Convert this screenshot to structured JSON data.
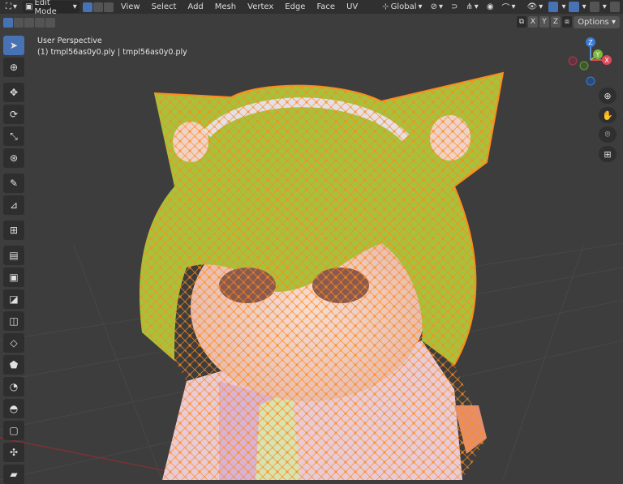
{
  "topbar": {
    "editor_icon": "viewport-icon",
    "mode_label": "Edit Mode",
    "menus": [
      "View",
      "Select",
      "Add",
      "Mesh",
      "Vertex",
      "Edge",
      "Face",
      "UV"
    ],
    "transform_orientation": "Global"
  },
  "header2": {
    "axes": [
      "X",
      "Y",
      "Z"
    ],
    "options_label": "Options"
  },
  "overlay": {
    "view_name": "User Perspective",
    "object_name": "(1) tmpl56as0y0.ply | tmpl56as0y0.ply"
  },
  "gizmo": {
    "z": "Z",
    "y": "Y",
    "x": "X"
  },
  "colors": {
    "accent": "#4772b3",
    "mesh_edges": "#ff8a1a",
    "hair": "#a4c23a",
    "skin": "#f3cfc2"
  }
}
